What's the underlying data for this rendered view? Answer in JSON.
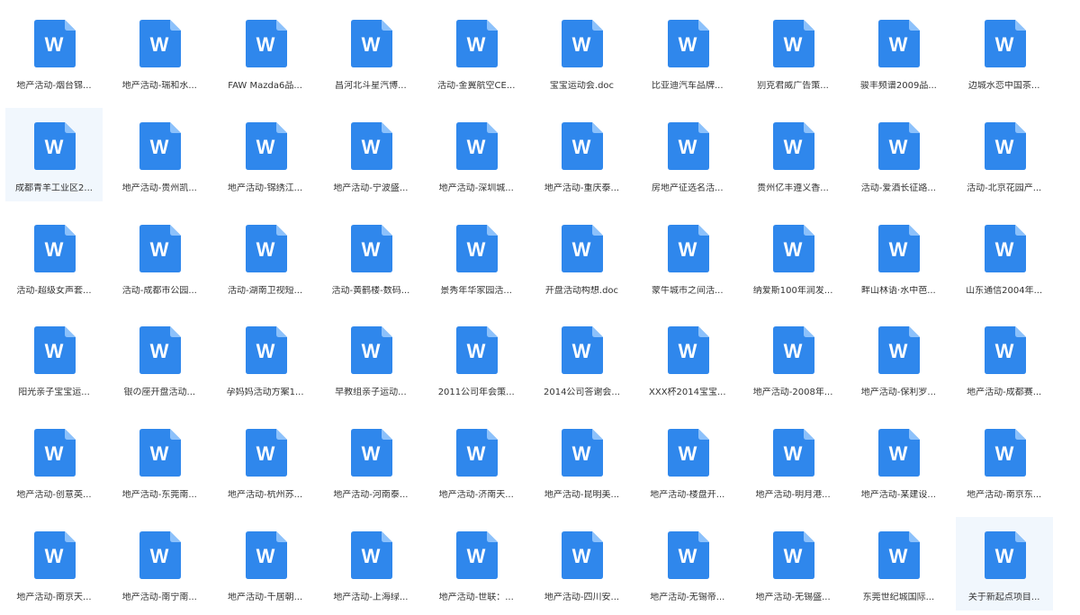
{
  "colors": {
    "icon_blue": "#2f87ec",
    "icon_fold": "#8cc1fb",
    "selection": "#f1f7fd"
  },
  "icon": {
    "name": "word-document-icon",
    "glyph": "W"
  },
  "files": [
    {
      "label": "地产活动-烟台锦..."
    },
    {
      "label": "地产活动-瑞和水..."
    },
    {
      "label": "FAW Mazda6品..."
    },
    {
      "label": "昌河北斗星汽博..."
    },
    {
      "label": "活动-金翼航空CE..."
    },
    {
      "label": "宝宝运动会.doc"
    },
    {
      "label": "比亚迪汽车品牌..."
    },
    {
      "label": "别克君威广告策..."
    },
    {
      "label": "骏丰频谱2009品..."
    },
    {
      "label": "边城水恋中国茶..."
    },
    {
      "label": "成都青羊工业区2...",
      "selected": true
    },
    {
      "label": "地产活动-贵州凯..."
    },
    {
      "label": "地产活动-锦绣江..."
    },
    {
      "label": "地产活动-宁波盛..."
    },
    {
      "label": "地产活动-深圳城..."
    },
    {
      "label": "地产活动-重庆泰..."
    },
    {
      "label": "房地产征选名活..."
    },
    {
      "label": "贵州亿丰遵义香..."
    },
    {
      "label": "活动-爱酒长征路..."
    },
    {
      "label": "活动-北京花园产..."
    },
    {
      "label": "活动-超级女声套..."
    },
    {
      "label": "活动-成都市公园..."
    },
    {
      "label": "活动-湖南卫视短..."
    },
    {
      "label": "活动-黄鹤楼-数码..."
    },
    {
      "label": "景秀年华家园活..."
    },
    {
      "label": "开盘活动构想.doc"
    },
    {
      "label": "蒙牛城市之间活..."
    },
    {
      "label": "纳爱斯100年润发..."
    },
    {
      "label": "畔山林语·水中芭..."
    },
    {
      "label": "山东通信2004年..."
    },
    {
      "label": "阳光亲子宝宝运..."
    },
    {
      "label": "银の座开盘活动..."
    },
    {
      "label": "孕妈妈活动方案1..."
    },
    {
      "label": "早教组亲子运动..."
    },
    {
      "label": "2011公司年会策..."
    },
    {
      "label": "2014公司答谢会..."
    },
    {
      "label": "XXX杯2014宝宝..."
    },
    {
      "label": "地产活动-2008年..."
    },
    {
      "label": "地产活动-保利罗..."
    },
    {
      "label": "地产活动-成都赛..."
    },
    {
      "label": "地产活动-创意英..."
    },
    {
      "label": "地产活动-东莞南..."
    },
    {
      "label": "地产活动-杭州苏..."
    },
    {
      "label": "地产活动-河南泰..."
    },
    {
      "label": "地产活动-济南天..."
    },
    {
      "label": "地产活动-昆明美..."
    },
    {
      "label": "地产活动-楼盘开..."
    },
    {
      "label": "地产活动-明月港..."
    },
    {
      "label": "地产活动-某建设..."
    },
    {
      "label": "地产活动-南京东..."
    },
    {
      "label": "地产活动-南京天..."
    },
    {
      "label": "地产活动-南宁南..."
    },
    {
      "label": "地产活动-千居朝..."
    },
    {
      "label": "地产活动-上海绿..."
    },
    {
      "label": "地产活动-世联：..."
    },
    {
      "label": "地产活动-四川安..."
    },
    {
      "label": "地产活动-无锡帝..."
    },
    {
      "label": "地产活动-无锡盛..."
    },
    {
      "label": "东莞世纪城国际..."
    },
    {
      "label": "关于新起点项目...",
      "selected": true
    }
  ]
}
